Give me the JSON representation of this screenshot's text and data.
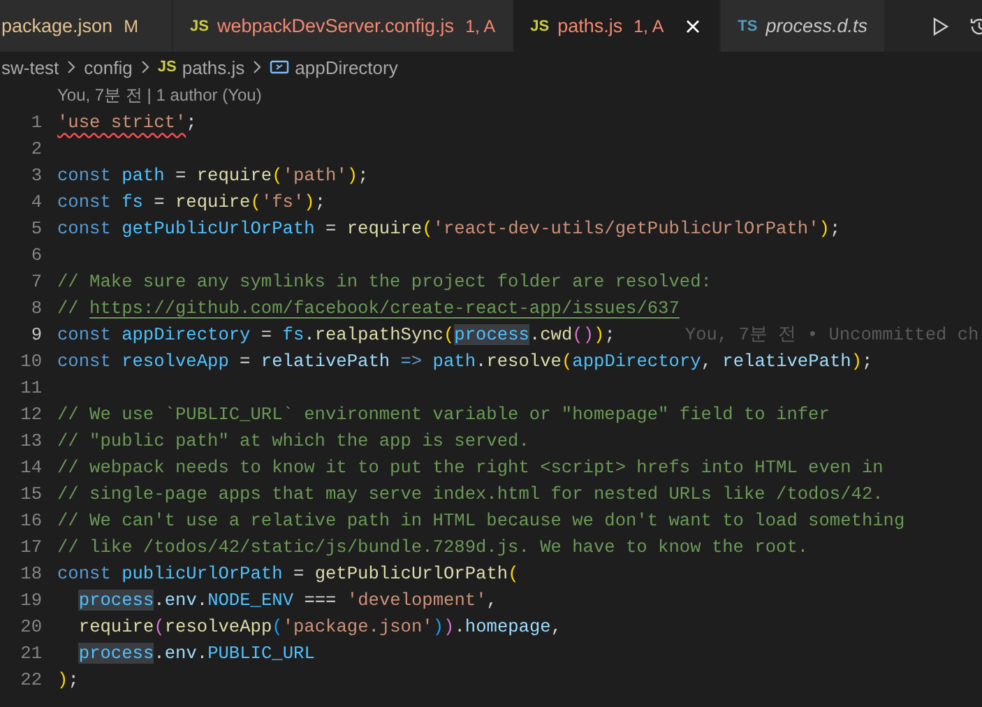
{
  "tabs": [
    {
      "label": "package.json",
      "status": "M",
      "modified": true,
      "has_error": false,
      "selected": false,
      "preview": false,
      "closable": false
    },
    {
      "icon": "JS",
      "label": "webpackDevServer.config.js",
      "status": "1, A",
      "modified": false,
      "has_error": true,
      "selected": false,
      "preview": false,
      "closable": false
    },
    {
      "icon": "JS",
      "label": "paths.js",
      "status": "1, A",
      "modified": false,
      "has_error": true,
      "selected": true,
      "preview": false,
      "closable": true
    },
    {
      "icon": "TS",
      "label": "process.d.ts",
      "modified": false,
      "has_error": false,
      "selected": false,
      "preview": true,
      "closable": false
    }
  ],
  "breadcrumbs": [
    {
      "kind": "folder",
      "text": "sw-test"
    },
    {
      "kind": "folder",
      "text": "config"
    },
    {
      "kind": "file",
      "icon": "JS",
      "text": "paths.js"
    },
    {
      "kind": "symbol",
      "text": "appDirectory"
    }
  ],
  "codelens": "You, 7분 전 | 1 author (You)",
  "lines": [
    {
      "number": "1",
      "current": false,
      "tokens": [
        {
          "kind": "str",
          "text": "'use strict'",
          "error": true
        },
        {
          "kind": "p",
          "text": ";"
        }
      ]
    },
    {
      "number": "2",
      "current": false
    },
    {
      "number": "3",
      "current": false,
      "tokens": [
        {
          "kind": "kw",
          "text": "const "
        },
        {
          "kind": "var",
          "text": "path"
        },
        {
          "kind": "p",
          "text": " = "
        },
        {
          "kind": "fn",
          "text": "require"
        },
        {
          "kind": "b1",
          "text": "("
        },
        {
          "kind": "str",
          "text": "'path'"
        },
        {
          "kind": "b1",
          "text": ")"
        },
        {
          "kind": "p",
          "text": ";"
        }
      ]
    },
    {
      "number": "4",
      "current": false,
      "tokens": [
        {
          "kind": "kw",
          "text": "const "
        },
        {
          "kind": "var",
          "text": "fs"
        },
        {
          "kind": "p",
          "text": " = "
        },
        {
          "kind": "fn",
          "text": "require"
        },
        {
          "kind": "b1",
          "text": "("
        },
        {
          "kind": "str",
          "text": "'fs'"
        },
        {
          "kind": "b1",
          "text": ")"
        },
        {
          "kind": "p",
          "text": ";"
        }
      ]
    },
    {
      "number": "5",
      "current": false,
      "tokens": [
        {
          "kind": "kw",
          "text": "const "
        },
        {
          "kind": "var",
          "text": "getPublicUrlOrPath"
        },
        {
          "kind": "p",
          "text": " = "
        },
        {
          "kind": "fn",
          "text": "require"
        },
        {
          "kind": "b1",
          "text": "("
        },
        {
          "kind": "str",
          "text": "'react-dev-utils/getPublicUrlOrPath'"
        },
        {
          "kind": "b1",
          "text": ")"
        },
        {
          "kind": "p",
          "text": ";"
        }
      ]
    },
    {
      "number": "6",
      "current": false
    },
    {
      "number": "7",
      "current": false,
      "tokens": [
        {
          "kind": "cm",
          "text": "// Make sure any symlinks in the project folder are resolved:"
        }
      ]
    },
    {
      "number": "8",
      "current": false,
      "tokens": [
        {
          "kind": "cm",
          "text": "// "
        },
        {
          "kind": "link",
          "text": "https://github.com/facebook/create-react-app/issues/637"
        }
      ]
    },
    {
      "number": "9",
      "current": true,
      "blame": "You, 7분 전 • Uncommitted ch",
      "tokens": [
        {
          "kind": "kw",
          "text": "const "
        },
        {
          "kind": "var",
          "text": "appDirectory"
        },
        {
          "kind": "p",
          "text": " = "
        },
        {
          "kind": "var",
          "text": "fs"
        },
        {
          "kind": "p",
          "text": "."
        },
        {
          "kind": "fn",
          "text": "realpathSync"
        },
        {
          "kind": "b1",
          "text": "("
        },
        {
          "kind": "var",
          "text": "process",
          "highlighted": true
        },
        {
          "kind": "p",
          "text": "."
        },
        {
          "kind": "fn",
          "text": "cwd"
        },
        {
          "kind": "b2",
          "text": "()"
        },
        {
          "kind": "b1",
          "text": ")"
        },
        {
          "kind": "p",
          "text": ";"
        }
      ]
    },
    {
      "number": "10",
      "current": false,
      "tokens": [
        {
          "kind": "kw",
          "text": "const "
        },
        {
          "kind": "var",
          "text": "resolveApp"
        },
        {
          "kind": "p",
          "text": " = "
        },
        {
          "kind": "param",
          "text": "relativePath"
        },
        {
          "kind": "kw",
          "text": " => "
        },
        {
          "kind": "var",
          "text": "path"
        },
        {
          "kind": "p",
          "text": "."
        },
        {
          "kind": "fn",
          "text": "resolve"
        },
        {
          "kind": "b1",
          "text": "("
        },
        {
          "kind": "var",
          "text": "appDirectory"
        },
        {
          "kind": "p",
          "text": ", "
        },
        {
          "kind": "param",
          "text": "relativePath"
        },
        {
          "kind": "b1",
          "text": ")"
        },
        {
          "kind": "p",
          "text": ";"
        }
      ]
    },
    {
      "number": "11",
      "current": false
    },
    {
      "number": "12",
      "current": false,
      "tokens": [
        {
          "kind": "cm",
          "text": "// We use `PUBLIC_URL` environment variable or \"homepage\" field to infer"
        }
      ]
    },
    {
      "number": "13",
      "current": false,
      "tokens": [
        {
          "kind": "cm",
          "text": "// \"public path\" at which the app is served."
        }
      ]
    },
    {
      "number": "14",
      "current": false,
      "tokens": [
        {
          "kind": "cm",
          "text": "// webpack needs to know it to put the right <script> hrefs into HTML even in"
        }
      ]
    },
    {
      "number": "15",
      "current": false,
      "tokens": [
        {
          "kind": "cm",
          "text": "// single-page apps that may serve index.html for nested URLs like /todos/42."
        }
      ]
    },
    {
      "number": "16",
      "current": false,
      "tokens": [
        {
          "kind": "cm",
          "text": "// We can't use a relative path in HTML because we don't want to load something"
        }
      ]
    },
    {
      "number": "17",
      "current": false,
      "tokens": [
        {
          "kind": "cm",
          "text": "// like /todos/42/static/js/bundle.7289d.js. We have to know the root."
        }
      ]
    },
    {
      "number": "18",
      "current": false,
      "tokens": [
        {
          "kind": "kw",
          "text": "const "
        },
        {
          "kind": "var",
          "text": "publicUrlOrPath"
        },
        {
          "kind": "p",
          "text": " = "
        },
        {
          "kind": "fn",
          "text": "getPublicUrlOrPath"
        },
        {
          "kind": "b1",
          "text": "("
        }
      ]
    },
    {
      "number": "19",
      "current": false,
      "indented": true,
      "tokens": [
        {
          "kind": "var",
          "text": "process",
          "highlighted": true
        },
        {
          "kind": "p",
          "text": "."
        },
        {
          "kind": "prop",
          "text": "env"
        },
        {
          "kind": "p",
          "text": "."
        },
        {
          "kind": "var",
          "text": "NODE_ENV"
        },
        {
          "kind": "p",
          "text": " === "
        },
        {
          "kind": "str",
          "text": "'development'"
        },
        {
          "kind": "p",
          "text": ","
        }
      ]
    },
    {
      "number": "20",
      "current": false,
      "indented": true,
      "tokens": [
        {
          "kind": "fn",
          "text": "require"
        },
        {
          "kind": "b2",
          "text": "("
        },
        {
          "kind": "fn",
          "text": "resolveApp"
        },
        {
          "kind": "b3",
          "text": "("
        },
        {
          "kind": "str",
          "text": "'package.json'"
        },
        {
          "kind": "b3",
          "text": ")"
        },
        {
          "kind": "b2",
          "text": ")"
        },
        {
          "kind": "p",
          "text": "."
        },
        {
          "kind": "prop",
          "text": "homepage"
        },
        {
          "kind": "p",
          "text": ","
        }
      ]
    },
    {
      "number": "21",
      "current": false,
      "indented": true,
      "tokens": [
        {
          "kind": "var",
          "text": "process",
          "highlighted": true
        },
        {
          "kind": "p",
          "text": "."
        },
        {
          "kind": "prop",
          "text": "env"
        },
        {
          "kind": "p",
          "text": "."
        },
        {
          "kind": "var",
          "text": "PUBLIC_URL"
        }
      ]
    },
    {
      "number": "22",
      "current": false,
      "tokens": [
        {
          "kind": "b1",
          "text": ")"
        },
        {
          "kind": "p",
          "text": ";"
        }
      ]
    }
  ]
}
